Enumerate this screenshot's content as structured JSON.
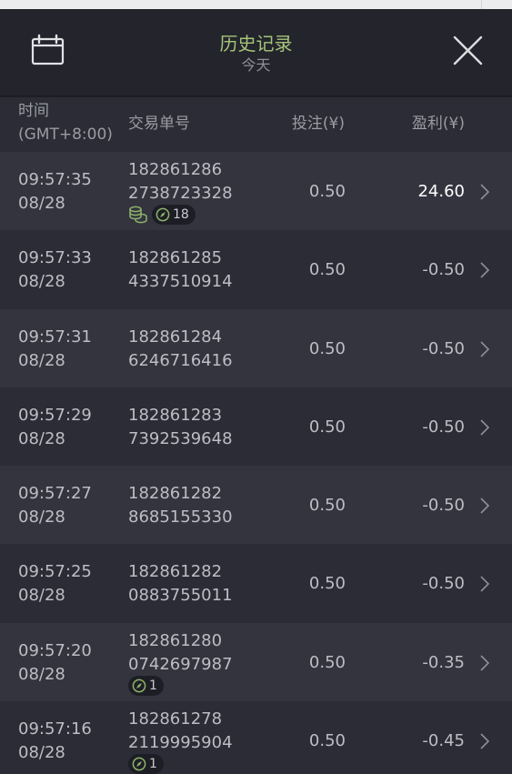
{
  "header": {
    "title": "历史记录",
    "subtitle": "今天",
    "calendar_icon": "calendar-icon",
    "close_icon": "close-icon"
  },
  "columns": {
    "time": "时间\n(GMT+8:00)",
    "trade_id": "交易单号",
    "stake": "投注(¥)",
    "profit": "盈利(¥)"
  },
  "colors": {
    "title": "#a6c47a",
    "badge_icon": "#8fb36a"
  },
  "rows": [
    {
      "time": "09:57:35",
      "date": "08/28",
      "id1": "182861286",
      "id2": "2738723328",
      "stake": "0.50",
      "profit": "24.60",
      "coins": true,
      "count": "18"
    },
    {
      "time": "09:57:33",
      "date": "08/28",
      "id1": "182861285",
      "id2": "4337510914",
      "stake": "0.50",
      "profit": "-0.50"
    },
    {
      "time": "09:57:31",
      "date": "08/28",
      "id1": "182861284",
      "id2": "6246716416",
      "stake": "0.50",
      "profit": "-0.50"
    },
    {
      "time": "09:57:29",
      "date": "08/28",
      "id1": "182861283",
      "id2": "7392539648",
      "stake": "0.50",
      "profit": "-0.50"
    },
    {
      "time": "09:57:27",
      "date": "08/28",
      "id1": "182861282",
      "id2": "8685155330",
      "stake": "0.50",
      "profit": "-0.50"
    },
    {
      "time": "09:57:25",
      "date": "08/28",
      "id1": "182861282",
      "id2": "0883755011",
      "stake": "0.50",
      "profit": "-0.50"
    },
    {
      "time": "09:57:20",
      "date": "08/28",
      "id1": "182861280",
      "id2": "0742697987",
      "stake": "0.50",
      "profit": "-0.35",
      "count": "1"
    },
    {
      "time": "09:57:16",
      "date": "08/28",
      "id1": "182861278",
      "id2": "2119995904",
      "stake": "0.50",
      "profit": "-0.45",
      "count": "1"
    }
  ]
}
